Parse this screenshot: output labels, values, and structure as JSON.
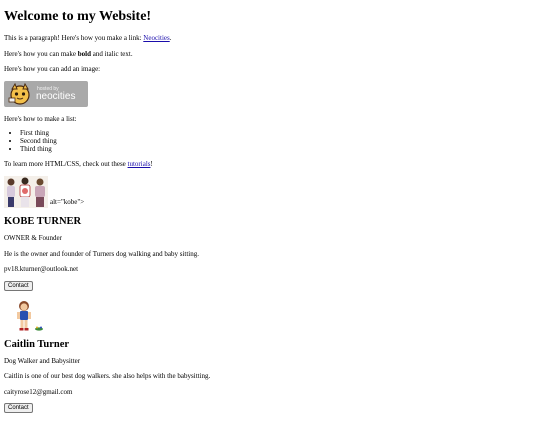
{
  "page": {
    "title": "Welcome to my Website!",
    "intro": {
      "before_link": "This is a paragraph! Here's how you make a link: ",
      "link_label": "Neocities",
      "after_link": "."
    },
    "bold_line": {
      "before": "Here's how you can make ",
      "bold": "bold",
      "after": " and italic text."
    },
    "image_line": "Here's how you can add an image:",
    "badge": {
      "small_text": "hosted by",
      "big_text": "neocities"
    },
    "list_intro": "Here's how to make a list:",
    "list_items": [
      "First thing",
      "Second thing",
      "Third thing"
    ],
    "learn": {
      "before_link": "To learn more HTML/CSS, check out these ",
      "link_label": "tutorials",
      "after_link": "!"
    },
    "broken_alt_text": "alt=\"kobe\">"
  },
  "profiles": [
    {
      "name": "KOBE TURNER",
      "role": "OWNER & Founder",
      "bio": "He is the owner and founder of Turners dog walking and baby sitting.",
      "email": "pv18.kturner@outlook.net",
      "contact_label": "Contact"
    },
    {
      "name": "Caitlin Turner",
      "role": "Dog Walker and Babysitter",
      "bio": "Caitlin is one of our best dog walkers. she also helps with the babysitting.",
      "email": "caityrose12@gmail.com",
      "contact_label": "Contact"
    }
  ],
  "colors": {
    "link": "#1a0dab",
    "badge_bg": "#a9a9a9",
    "button_bg": "#efefef"
  }
}
